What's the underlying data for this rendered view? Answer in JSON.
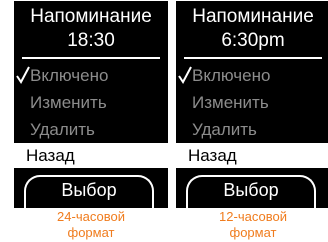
{
  "accent_color": "#f07c1e",
  "screens": [
    {
      "title": "Напоминание",
      "time": "18:30",
      "menu": [
        {
          "label": "Включено",
          "checked": true
        },
        {
          "label": "Изменить"
        },
        {
          "label": "Удалить"
        },
        {
          "label": "Назад",
          "selected": true
        }
      ],
      "softkey": "Выбор",
      "caption_line1": "24-часовой",
      "caption_line2": "формат"
    },
    {
      "title": "Напоминание",
      "time": "6:30pm",
      "menu": [
        {
          "label": "Включено",
          "checked": true
        },
        {
          "label": "Изменить"
        },
        {
          "label": "Удалить"
        },
        {
          "label": "Назад",
          "selected": true
        }
      ],
      "softkey": "Выбор",
      "caption_line1": "12-часовой",
      "caption_line2": "формат"
    }
  ]
}
